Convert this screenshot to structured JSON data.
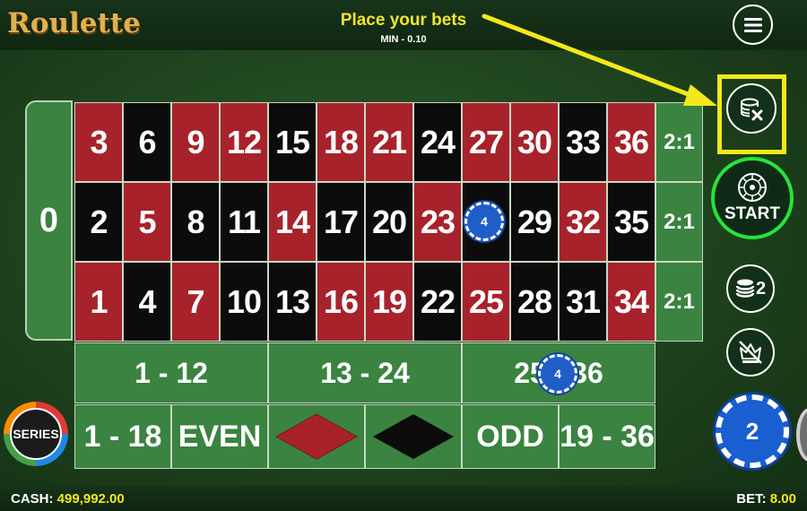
{
  "header": {
    "logo": "Roulette",
    "title": "Place your bets",
    "min_bet": "MIN - 0.10"
  },
  "board": {
    "zero": "0",
    "rows": [
      {
        "numbers": [
          "3",
          "6",
          "9",
          "12",
          "15",
          "18",
          "21",
          "24",
          "27",
          "30",
          "33",
          "36"
        ],
        "colors": [
          "red",
          "black",
          "red",
          "red",
          "black",
          "red",
          "red",
          "black",
          "red",
          "red",
          "black",
          "red"
        ]
      },
      {
        "numbers": [
          "2",
          "5",
          "8",
          "11",
          "14",
          "17",
          "20",
          "23",
          "26",
          "29",
          "32",
          "35"
        ],
        "colors": [
          "black",
          "red",
          "black",
          "black",
          "red",
          "black",
          "black",
          "red",
          "black",
          "black",
          "red",
          "black"
        ]
      },
      {
        "numbers": [
          "1",
          "4",
          "7",
          "10",
          "13",
          "16",
          "19",
          "22",
          "25",
          "28",
          "31",
          "34"
        ],
        "colors": [
          "red",
          "black",
          "red",
          "black",
          "black",
          "red",
          "red",
          "black",
          "red",
          "black",
          "black",
          "red"
        ]
      }
    ],
    "column_bets": [
      "2:1",
      "2:1",
      "2:1"
    ],
    "dozens": [
      "1 - 12",
      "13 - 24",
      "25 - 36"
    ],
    "outside": {
      "low": "1 - 18",
      "even": "EVEN",
      "red": "red-diamond",
      "black": "black-diamond",
      "odd": "ODD",
      "high": "19 - 36"
    },
    "placed_chips": [
      {
        "on": "26",
        "value": "4"
      },
      {
        "on": "25 - 36",
        "value": "4"
      }
    ]
  },
  "controls": {
    "menu_icon": "hamburger-menu-icon",
    "undo_icon": "clear-bets-icon",
    "start_label": "START",
    "double_label": "2",
    "series_label": "SERIES",
    "selected_chip": "2"
  },
  "footer": {
    "cash_label": "CASH:",
    "cash_value": "499,992.00",
    "bet_label": "BET:",
    "bet_value": "8.00"
  },
  "colors": {
    "felt": "#2e5a2a",
    "red": "#a8222b",
    "black": "#0c0c0c",
    "accent_yellow": "#f3e81b",
    "start_ring": "#27e33c",
    "chip_blue": "#1f5ec9"
  }
}
